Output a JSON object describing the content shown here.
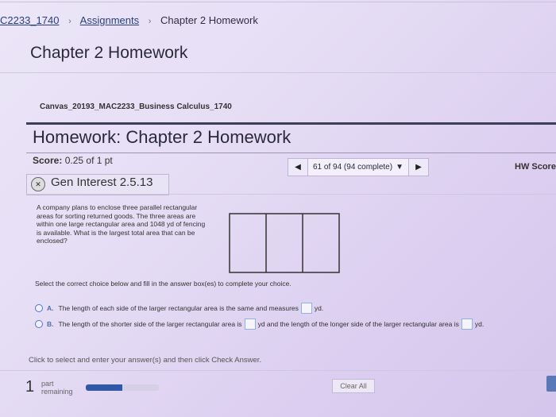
{
  "breadcrumb": {
    "course": "C2233_1740",
    "assignments": "Assignments",
    "current": "Chapter 2 Homework",
    "sep": "›"
  },
  "page_title": "Chapter 2 Homework",
  "course_name": "Canvas_20193_MAC2233_Business Calculus_1740",
  "homework_title": "Homework: Chapter 2 Homework",
  "score": {
    "label": "Score:",
    "value": "0.25 of 1 pt"
  },
  "nav": {
    "prev_icon": "◀",
    "position": "61 of 94 (94 complete)",
    "dropdown_icon": "▼",
    "next_icon": "▶"
  },
  "hw_score": "HW Score",
  "question": {
    "title": "Gen Interest 2.5.13",
    "icon": "partial-credit-icon"
  },
  "problem_text": "A company plans to enclose three parallel rectangular areas for sorting returned goods. The three areas are within one large rectangular area and 1048 yd of fencing is available. What is the largest total area that can be enclosed?",
  "instruction": "Select the correct choice below and fill in the answer box(es) to complete your choice.",
  "choices": {
    "a": {
      "label": "A.",
      "text1": "The length of each side of the larger rectangular area is the same and measures",
      "unit": "yd."
    },
    "b": {
      "label": "B.",
      "text1": "The length of the shorter side of the larger rectangular area is",
      "text2": "yd and the length of the longer side of the larger rectangular area is",
      "unit": "yd."
    }
  },
  "hint": "Click to select and enter your answer(s) and then click Check Answer.",
  "parts_remaining": {
    "count": "1",
    "label1": "part",
    "label2": "remaining",
    "progress": 0.5
  },
  "clear_all": "Clear All",
  "colors": {
    "accent": "#3158a8",
    "title_bar": "#3b3f58"
  }
}
